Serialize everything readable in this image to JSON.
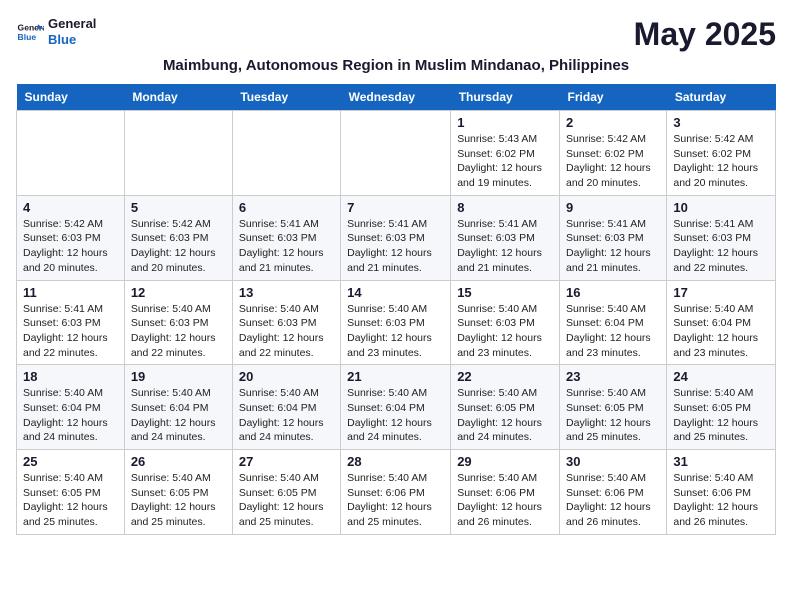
{
  "header": {
    "logo_line1": "General",
    "logo_line2": "Blue",
    "month_title": "May 2025",
    "subtitle": "Maimbung, Autonomous Region in Muslim Mindanao, Philippines"
  },
  "weekdays": [
    "Sunday",
    "Monday",
    "Tuesday",
    "Wednesday",
    "Thursday",
    "Friday",
    "Saturday"
  ],
  "weeks": [
    [
      {
        "day": "",
        "info": ""
      },
      {
        "day": "",
        "info": ""
      },
      {
        "day": "",
        "info": ""
      },
      {
        "day": "",
        "info": ""
      },
      {
        "day": "1",
        "info": "Sunrise: 5:43 AM\nSunset: 6:02 PM\nDaylight: 12 hours and 19 minutes."
      },
      {
        "day": "2",
        "info": "Sunrise: 5:42 AM\nSunset: 6:02 PM\nDaylight: 12 hours and 20 minutes."
      },
      {
        "day": "3",
        "info": "Sunrise: 5:42 AM\nSunset: 6:02 PM\nDaylight: 12 hours and 20 minutes."
      }
    ],
    [
      {
        "day": "4",
        "info": "Sunrise: 5:42 AM\nSunset: 6:03 PM\nDaylight: 12 hours and 20 minutes."
      },
      {
        "day": "5",
        "info": "Sunrise: 5:42 AM\nSunset: 6:03 PM\nDaylight: 12 hours and 20 minutes."
      },
      {
        "day": "6",
        "info": "Sunrise: 5:41 AM\nSunset: 6:03 PM\nDaylight: 12 hours and 21 minutes."
      },
      {
        "day": "7",
        "info": "Sunrise: 5:41 AM\nSunset: 6:03 PM\nDaylight: 12 hours and 21 minutes."
      },
      {
        "day": "8",
        "info": "Sunrise: 5:41 AM\nSunset: 6:03 PM\nDaylight: 12 hours and 21 minutes."
      },
      {
        "day": "9",
        "info": "Sunrise: 5:41 AM\nSunset: 6:03 PM\nDaylight: 12 hours and 21 minutes."
      },
      {
        "day": "10",
        "info": "Sunrise: 5:41 AM\nSunset: 6:03 PM\nDaylight: 12 hours and 22 minutes."
      }
    ],
    [
      {
        "day": "11",
        "info": "Sunrise: 5:41 AM\nSunset: 6:03 PM\nDaylight: 12 hours and 22 minutes."
      },
      {
        "day": "12",
        "info": "Sunrise: 5:40 AM\nSunset: 6:03 PM\nDaylight: 12 hours and 22 minutes."
      },
      {
        "day": "13",
        "info": "Sunrise: 5:40 AM\nSunset: 6:03 PM\nDaylight: 12 hours and 22 minutes."
      },
      {
        "day": "14",
        "info": "Sunrise: 5:40 AM\nSunset: 6:03 PM\nDaylight: 12 hours and 23 minutes."
      },
      {
        "day": "15",
        "info": "Sunrise: 5:40 AM\nSunset: 6:03 PM\nDaylight: 12 hours and 23 minutes."
      },
      {
        "day": "16",
        "info": "Sunrise: 5:40 AM\nSunset: 6:04 PM\nDaylight: 12 hours and 23 minutes."
      },
      {
        "day": "17",
        "info": "Sunrise: 5:40 AM\nSunset: 6:04 PM\nDaylight: 12 hours and 23 minutes."
      }
    ],
    [
      {
        "day": "18",
        "info": "Sunrise: 5:40 AM\nSunset: 6:04 PM\nDaylight: 12 hours and 24 minutes."
      },
      {
        "day": "19",
        "info": "Sunrise: 5:40 AM\nSunset: 6:04 PM\nDaylight: 12 hours and 24 minutes."
      },
      {
        "day": "20",
        "info": "Sunrise: 5:40 AM\nSunset: 6:04 PM\nDaylight: 12 hours and 24 minutes."
      },
      {
        "day": "21",
        "info": "Sunrise: 5:40 AM\nSunset: 6:04 PM\nDaylight: 12 hours and 24 minutes."
      },
      {
        "day": "22",
        "info": "Sunrise: 5:40 AM\nSunset: 6:05 PM\nDaylight: 12 hours and 24 minutes."
      },
      {
        "day": "23",
        "info": "Sunrise: 5:40 AM\nSunset: 6:05 PM\nDaylight: 12 hours and 25 minutes."
      },
      {
        "day": "24",
        "info": "Sunrise: 5:40 AM\nSunset: 6:05 PM\nDaylight: 12 hours and 25 minutes."
      }
    ],
    [
      {
        "day": "25",
        "info": "Sunrise: 5:40 AM\nSunset: 6:05 PM\nDaylight: 12 hours and 25 minutes."
      },
      {
        "day": "26",
        "info": "Sunrise: 5:40 AM\nSunset: 6:05 PM\nDaylight: 12 hours and 25 minutes."
      },
      {
        "day": "27",
        "info": "Sunrise: 5:40 AM\nSunset: 6:05 PM\nDaylight: 12 hours and 25 minutes."
      },
      {
        "day": "28",
        "info": "Sunrise: 5:40 AM\nSunset: 6:06 PM\nDaylight: 12 hours and 25 minutes."
      },
      {
        "day": "29",
        "info": "Sunrise: 5:40 AM\nSunset: 6:06 PM\nDaylight: 12 hours and 26 minutes."
      },
      {
        "day": "30",
        "info": "Sunrise: 5:40 AM\nSunset: 6:06 PM\nDaylight: 12 hours and 26 minutes."
      },
      {
        "day": "31",
        "info": "Sunrise: 5:40 AM\nSunset: 6:06 PM\nDaylight: 12 hours and 26 minutes."
      }
    ]
  ]
}
